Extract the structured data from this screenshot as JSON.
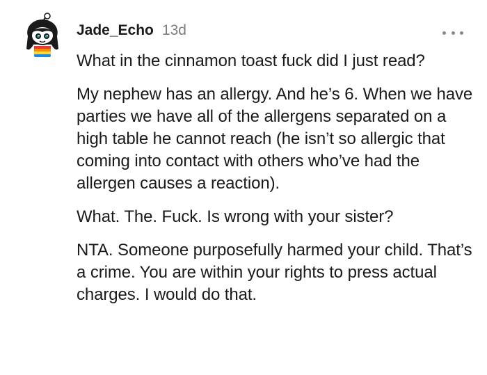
{
  "comment": {
    "username": "Jade_Echo",
    "age": "13d",
    "avatar_icon": "snoo-avatar-icon",
    "more_icon": "more-options-icon",
    "paragraphs": [
      "What in the cinnamon toast fuck did I just read?",
      "My nephew has an allergy. And he’s 6. When we have parties we have all of the allergens separated on a high table he cannot reach (he isn’t so allergic that coming into contact with others who’ve had the allergen causes a reaction).",
      "What. The. Fuck. Is wrong with your sister?",
      "NTA. Someone purposefully harmed your child. That’s a crime. You are within your rights to press actual charges. I would do that."
    ]
  }
}
